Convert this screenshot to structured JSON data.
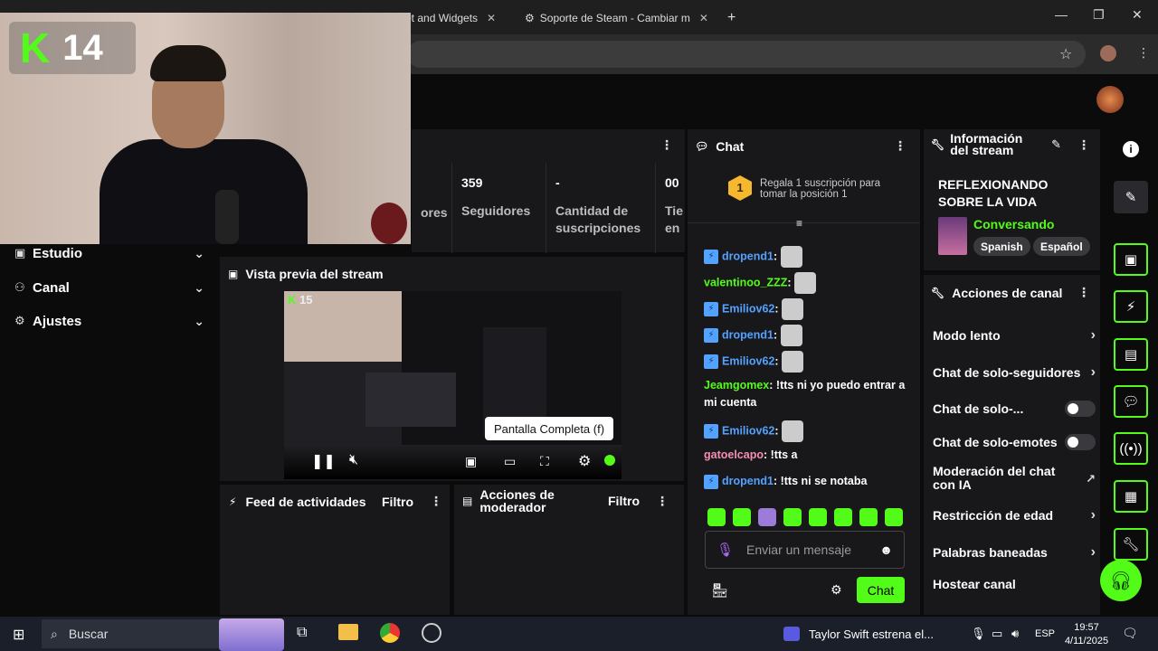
{
  "browser": {
    "tabs": [
      {
        "label": "ot and Widgets"
      },
      {
        "label": "Soporte de Steam - Cambiar m"
      }
    ],
    "new_tab": "+",
    "win_min": "—",
    "win_max": "❐",
    "win_close": "✕"
  },
  "overlay": {
    "logo_letter": "K",
    "logo_number": "14"
  },
  "leftnav": {
    "items": [
      {
        "label": "Estudio"
      },
      {
        "label": "Canal"
      },
      {
        "label": "Ajustes"
      }
    ]
  },
  "stats": {
    "cells": [
      {
        "value": "",
        "label": "ores"
      },
      {
        "value": "359",
        "label": "Seguidores"
      },
      {
        "value": "-",
        "label": "Cantidad de suscripciones"
      },
      {
        "value": "00",
        "label": "Tie en"
      }
    ]
  },
  "preview": {
    "title": "Vista previa del stream",
    "tooltip": "Pantalla Completa (f)",
    "inner_logo_number": "15"
  },
  "feed": {
    "title": "Feed de actividades",
    "filter": "Filtro"
  },
  "modactions": {
    "title": "Acciones de moderador",
    "filter": "Filtro"
  },
  "chat": {
    "title": "Chat",
    "gift_rank": "1",
    "gift_text": "Regala 1 suscripción para tomar la posición 1",
    "messages": [
      {
        "user": "dropend1",
        "text": "",
        "color": "#53a2ff",
        "badge": true,
        "emote": true
      },
      {
        "user": "valentinoo_ZZZ",
        "text": "",
        "color": "#53fc18",
        "badge": false,
        "emote": true
      },
      {
        "user": "Emiliov62",
        "text": "",
        "color": "#53a2ff",
        "badge": true,
        "emote": true
      },
      {
        "user": "dropend1",
        "text": "",
        "color": "#53a2ff",
        "badge": true,
        "emote": true
      },
      {
        "user": "Emiliov62",
        "text": "",
        "color": "#53a2ff",
        "badge": true,
        "emote": true
      },
      {
        "user": "Jeamgomex",
        "text": "!tts ni yo puedo entrar a mi cuenta",
        "color": "#53fc18",
        "badge": false,
        "emote": false
      },
      {
        "user": "Emiliov62",
        "text": "",
        "color": "#53a2ff",
        "badge": true,
        "emote": true
      },
      {
        "user": "gatoelcapo",
        "text": "!tts a",
        "color": "#f58fb0",
        "badge": false,
        "emote": false
      },
      {
        "user": "dropend1",
        "text": "!tts ni se notaba",
        "color": "#53a2ff",
        "badge": true,
        "emote": false
      }
    ],
    "input_placeholder": "Enviar un mensaje",
    "send_label": "Chat"
  },
  "info": {
    "title": "Información del stream",
    "stream_title": "REFLEXIONANDO SOBRE LA VIDA",
    "category": "Conversando",
    "tags": [
      "Spanish",
      "Español"
    ]
  },
  "channel_actions": {
    "title": "Acciones de canal",
    "items": [
      {
        "label": "Modo lento",
        "kind": "arrow"
      },
      {
        "label": "Chat de solo-seguidores",
        "kind": "arrow"
      },
      {
        "label": "Chat de solo-...",
        "kind": "toggle"
      },
      {
        "label": "Chat de solo-emotes",
        "kind": "toggle"
      },
      {
        "label": "Moderación del chat con IA",
        "kind": "external"
      },
      {
        "label": "Restricción de edad",
        "kind": "arrow"
      },
      {
        "label": "Palabras baneadas",
        "kind": "arrow"
      },
      {
        "label": "Hostear canal",
        "kind": "none"
      }
    ]
  },
  "taskbar": {
    "search_placeholder": "Buscar",
    "news": "Taylor Swift estrena el...",
    "lang": "ESP",
    "time": "19:57",
    "date": "4/11/2025"
  },
  "colors": {
    "kick_green": "#53fc18",
    "panel": "#18181b",
    "badge_blue": "#53a2ff"
  }
}
